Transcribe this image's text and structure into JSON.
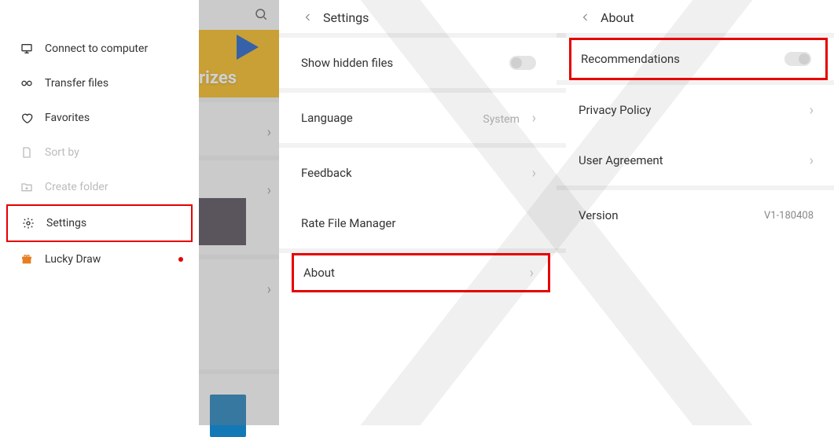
{
  "sidebar": {
    "items": [
      {
        "label": "Connect to computer",
        "icon": "computer-icon",
        "enabled": true
      },
      {
        "label": "Transfer files",
        "icon": "link-icon",
        "enabled": true
      },
      {
        "label": "Favorites",
        "icon": "heart-icon",
        "enabled": true
      },
      {
        "label": "Sort by",
        "icon": "file-icon",
        "enabled": false
      },
      {
        "label": "Create folder",
        "icon": "folder-add-icon",
        "enabled": false
      },
      {
        "label": "Settings",
        "icon": "gear-icon",
        "enabled": true,
        "highlighted": true
      },
      {
        "label": "Lucky Draw",
        "icon": "gift-icon",
        "enabled": true,
        "badge": true
      }
    ]
  },
  "mid": {
    "prizes_text": "rizes"
  },
  "settings_panel": {
    "title": "Settings",
    "rows": {
      "show_hidden": {
        "label": "Show hidden files"
      },
      "language": {
        "label": "Language",
        "value": "System"
      },
      "feedback": {
        "label": "Feedback"
      },
      "rate": {
        "label": "Rate File Manager"
      },
      "about": {
        "label": "About",
        "highlighted": true
      }
    }
  },
  "about_panel": {
    "title": "About",
    "rows": {
      "recommendations": {
        "label": "Recommendations",
        "highlighted": true
      },
      "privacy": {
        "label": "Privacy Policy"
      },
      "agreement": {
        "label": "User Agreement"
      },
      "version": {
        "label": "Version",
        "value": "V1-180408"
      }
    }
  }
}
